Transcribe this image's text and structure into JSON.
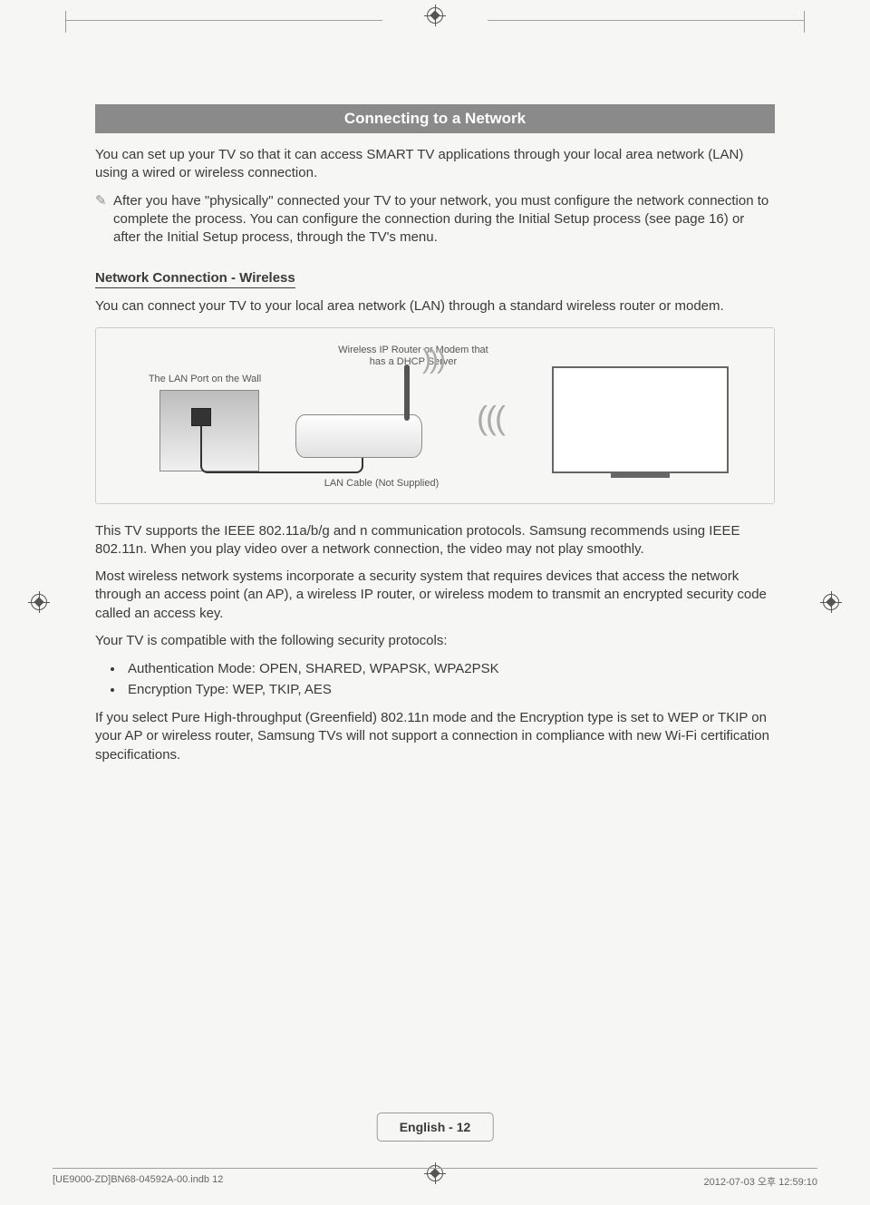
{
  "header": {
    "title": "Connecting to a Network"
  },
  "intro": "You can set up your TV so that it can access SMART TV applications through your local area network (LAN) using a wired or wireless connection.",
  "note": "After you have \"physically\" connected your TV to your network, you must configure the network connection to complete the process. You can configure the connection during the Initial Setup process (see page 16) or after the Initial Setup process, through the TV's menu.",
  "subheading": "Network Connection - Wireless",
  "sub_intro": "You can connect your TV to your local area network (LAN) through a standard wireless router or modem.",
  "diagram": {
    "lan_port": "The LAN Port on the Wall",
    "router": "Wireless IP Router or Modem that has a DHCP Server",
    "cable": "LAN Cable (Not Supplied)"
  },
  "body": {
    "p1": "This TV supports the IEEE 802.11a/b/g and n communication protocols. Samsung recommends using IEEE 802.11n. When you play video over a network connection, the video may not play smoothly.",
    "p2": "Most wireless network systems incorporate a security system that requires devices that access the network through an access point (an AP), a wireless IP router, or wireless modem to transmit an encrypted security code called an access key.",
    "p3": "Your TV is compatible with the following security protocols:",
    "bullets": [
      "Authentication Mode: OPEN, SHARED, WPAPSK, WPA2PSK",
      "Encryption Type: WEP, TKIP, AES"
    ],
    "p4": "If you select Pure High-throughput (Greenfield) 802.11n mode and the Encryption type is set to WEP or TKIP on your AP or wireless router, Samsung TVs will not support a connection in compliance with new Wi-Fi certification specifications."
  },
  "footer": {
    "page_label": "English - 12",
    "print_left": "[UE9000-ZD]BN68-04592A-00.indb   12",
    "print_right": "2012-07-03   오후 12:59:10"
  }
}
